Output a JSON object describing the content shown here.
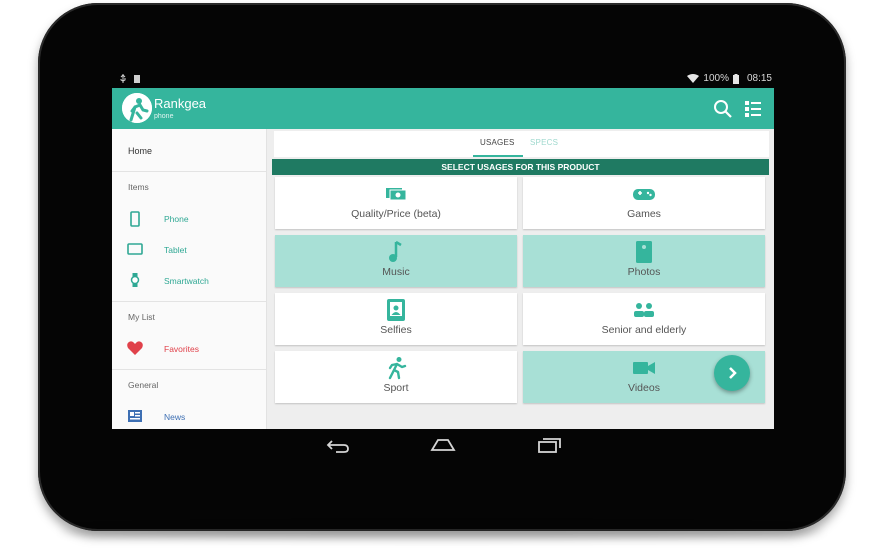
{
  "statusbar": {
    "battery": "100%",
    "time": "08:15"
  },
  "app": {
    "title": "Rankgea",
    "subtitle": "phone"
  },
  "drawer": {
    "home": "Home",
    "section_items": "Items",
    "items": [
      {
        "label": "Phone",
        "icon": "phone-icon"
      },
      {
        "label": "Tablet",
        "icon": "tablet-icon"
      },
      {
        "label": "Smartwatch",
        "icon": "smartwatch-icon"
      }
    ],
    "section_mylist": "My List",
    "favorites": {
      "label": "Favorites",
      "icon": "heart-icon"
    },
    "section_general": "General",
    "news": {
      "label": "News",
      "icon": "news-icon"
    }
  },
  "tabs": {
    "usages": "USAGES",
    "specs": "SPECS",
    "active": "USAGES"
  },
  "banner": "SELECT USAGES FOR THIS PRODUCT",
  "usages": [
    {
      "label": "Quality/Price (beta)",
      "icon": "money-icon",
      "selected": false
    },
    {
      "label": "Games",
      "icon": "gamepad-icon",
      "selected": false
    },
    {
      "label": "Music",
      "icon": "music-note-icon",
      "selected": true
    },
    {
      "label": "Photos",
      "icon": "photo-icon",
      "selected": true
    },
    {
      "label": "Selfies",
      "icon": "selfie-icon",
      "selected": false
    },
    {
      "label": "Senior and elderly",
      "icon": "seniors-icon",
      "selected": false
    },
    {
      "label": "Sport",
      "icon": "running-icon",
      "selected": false
    },
    {
      "label": "Videos",
      "icon": "video-camera-icon",
      "selected": true
    }
  ],
  "colors": {
    "accent": "#35b59d",
    "banner": "#1f7a62",
    "selected_card": "#a8e0d6",
    "favorites": "#e0414a"
  }
}
